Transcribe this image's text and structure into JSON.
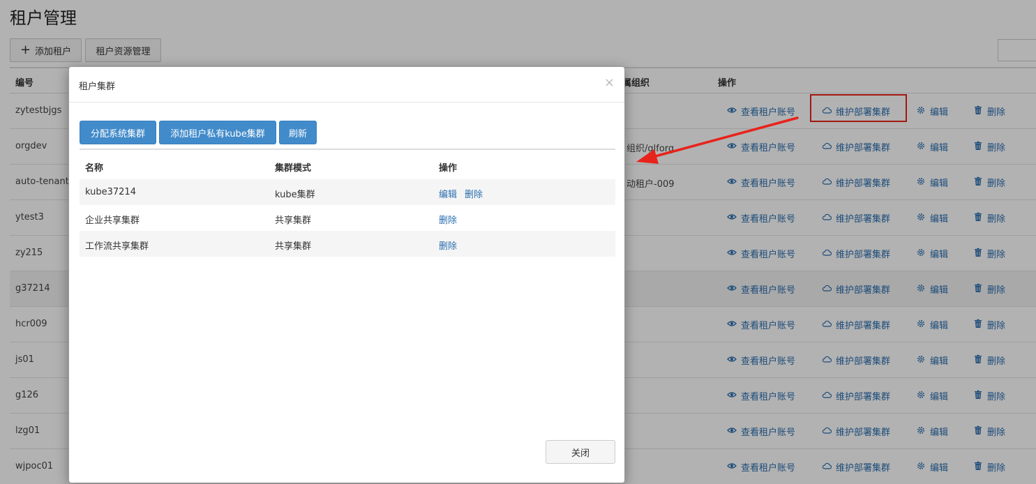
{
  "page": {
    "title": "租户管理",
    "toolbar": {
      "add_label": "添加租户",
      "resource_label": "租户资源管理"
    },
    "table": {
      "headers": {
        "id": "编号",
        "org": "属组织",
        "ops": "操作"
      },
      "actions": {
        "view": "查看租户账号",
        "maintain": "维护部署集群",
        "edit": "编辑",
        "delete": "删除"
      },
      "rows": [
        {
          "id": "zytestbjgs",
          "org": ""
        },
        {
          "id": "orgdev",
          "org": "组织/glforg"
        },
        {
          "id": "auto-tenant",
          "org": "动租户-009"
        },
        {
          "id": "ytest3",
          "org": ""
        },
        {
          "id": "zy215",
          "org": ""
        },
        {
          "id": "g37214",
          "org": ""
        },
        {
          "id": "hcr009",
          "org": ""
        },
        {
          "id": "js01",
          "org": ""
        },
        {
          "id": "g126",
          "org": ""
        },
        {
          "id": "lzg01",
          "org": ""
        },
        {
          "id": "wjpoc01",
          "org": ""
        }
      ]
    }
  },
  "modal": {
    "title": "租户集群",
    "close_symbol": "×",
    "buttons": {
      "assign": "分配系统集群",
      "add_private": "添加租户私有kube集群",
      "refresh": "刷新"
    },
    "headers": {
      "name": "名称",
      "mode": "集群模式",
      "ops": "操作"
    },
    "rows": [
      {
        "name": "kube37214",
        "mode": "kube集群",
        "edit": "编辑",
        "delete": "删除"
      },
      {
        "name": "企业共享集群",
        "mode": "共享集群",
        "delete": "删除"
      },
      {
        "name": "工作流共享集群",
        "mode": "共享集群",
        "delete": "删除"
      }
    ],
    "footer_close": "关闭"
  },
  "colors": {
    "primary": "#428bca",
    "link": "#2a6eaf",
    "annotation": "#e8231b"
  },
  "icons": {
    "add": "plus-icon",
    "view": "eye-icon",
    "maintain": "cloud-icon",
    "edit": "gear-icon",
    "delete": "trash-icon",
    "close": "close-icon"
  }
}
